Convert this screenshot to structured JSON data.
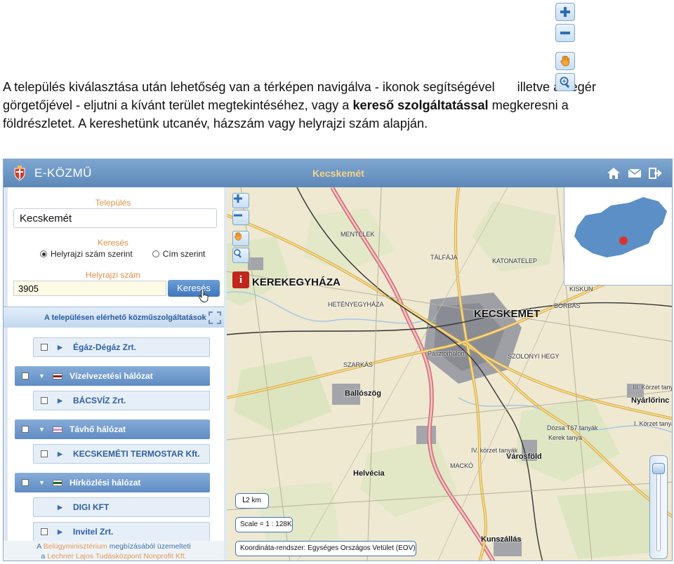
{
  "document": {
    "line1_before": "A település kiválasztása után lehetőség van a térképen navigálva - ikonok segítségével",
    "line1_after": "illetve az egér",
    "line2_before": "görgetőjével - eljutni a kívánt terület megtekintéséhez, vagy a",
    "line2_bold": "kereső szolgáltatással",
    "line2_after": "megkeresni a",
    "line3": "földrészletet. A kereshetünk utcanév, házszám vagy helyrajzi szám alapján."
  },
  "floating_toolbar": {
    "icons": [
      "zoom-in-icon",
      "zoom-out-icon",
      "pan-hand-icon",
      "magnifier-zoom-icon"
    ]
  },
  "header": {
    "app_title": "E-KÖZMŰ",
    "city": "Kecskemét",
    "icons": [
      "home-icon",
      "mail-icon",
      "logout-icon"
    ]
  },
  "search_panel": {
    "settlement_label": "Település",
    "settlement_value": "Kecskemét",
    "search_label": "Keresés",
    "radio_options": [
      {
        "label": "Helyrajzi szám szerint",
        "selected": true
      },
      {
        "label": "Cím szerint",
        "selected": false
      }
    ],
    "parcel_label": "Helyrajzi szám",
    "parcel_value": "3905",
    "search_button": "Keresés"
  },
  "services": {
    "title": "A településen elérhető közműszolgáltatások",
    "rows": [
      {
        "kind": "sub",
        "label": "Égáz-Dégáz Zrt.",
        "checkbox": true
      },
      {
        "kind": "cat",
        "label": "Vízelvezetési hálózat",
        "checkbox": true,
        "swatch": "#8a1c1c"
      },
      {
        "kind": "sub",
        "label": "BÁCSVÍZ Zrt.",
        "checkbox": true
      },
      {
        "kind": "cat",
        "label": "Távhő hálózat",
        "checkbox": true,
        "swatch": "#d98fd0"
      },
      {
        "kind": "sub",
        "label": "KECSKEMÉTI TERMOSTAR Kft.",
        "checkbox": true
      },
      {
        "kind": "cat",
        "label": "Hírközlési hálózat",
        "checkbox": true,
        "swatch": "#1e6b2a"
      },
      {
        "kind": "sub",
        "label": "DIGI KFT",
        "checkbox": false
      },
      {
        "kind": "sub",
        "label": "Invitel Zrt.",
        "checkbox": true
      }
    ]
  },
  "footer": {
    "line1_prefix": "A",
    "line1_accent": "Belügyminisztérium",
    "line1_suffix": "megbízásából üzemelteti",
    "line2_prefix": "a",
    "line2_accent": "Lechner Lajos Tudásközpont Nonprofit Kft."
  },
  "map": {
    "place_labels": {
      "kerekegyhaza": "KEREKEGYHÁZA",
      "kecskemet": "KECSKEMÉT",
      "ballosog": "Ballószög",
      "helvecia": "Helvécia",
      "varosfold": "Városföld",
      "kunszallas": "Kunszállás",
      "nyarlorinc": "Nyárlőrinc",
      "mentelek": "MENTELEK",
      "hetenyegyhaza": "HETÉNYEGYHÁZA",
      "szarkas": "SZARKÁS",
      "talfaja": "TÁLFÁJA",
      "borbas": "BORBÁS",
      "kiskun": "KISKUN",
      "kiskunfelep": "KATONATELEP",
      "szolonyi": "SZOLONYI HEGY",
      "pasztor": "Pásztorhalom",
      "irodalom": "III. Körzet tanya",
      "korzet1": "I. Körzet tanya",
      "korzet4": "IV. körzet tanyák",
      "kerek_tanya": "Kerek tanya",
      "daisy": "Dózsa T67 tanyák",
      "mackó": "MACKÓ"
    },
    "scale_bar": "2 km",
    "scale_text": "Scale = 1 : 128K",
    "coord_text": "Koordináta-rendszer: Egységes Országos Vetület (EOV)",
    "inset_label": "hungary-overview-map",
    "controls": [
      "zoom-in-icon",
      "zoom-out-icon",
      "pan-hand-icon",
      "magnifier-zoom-icon"
    ],
    "info_button": "i",
    "zoom_level_fraction": 0.95
  }
}
